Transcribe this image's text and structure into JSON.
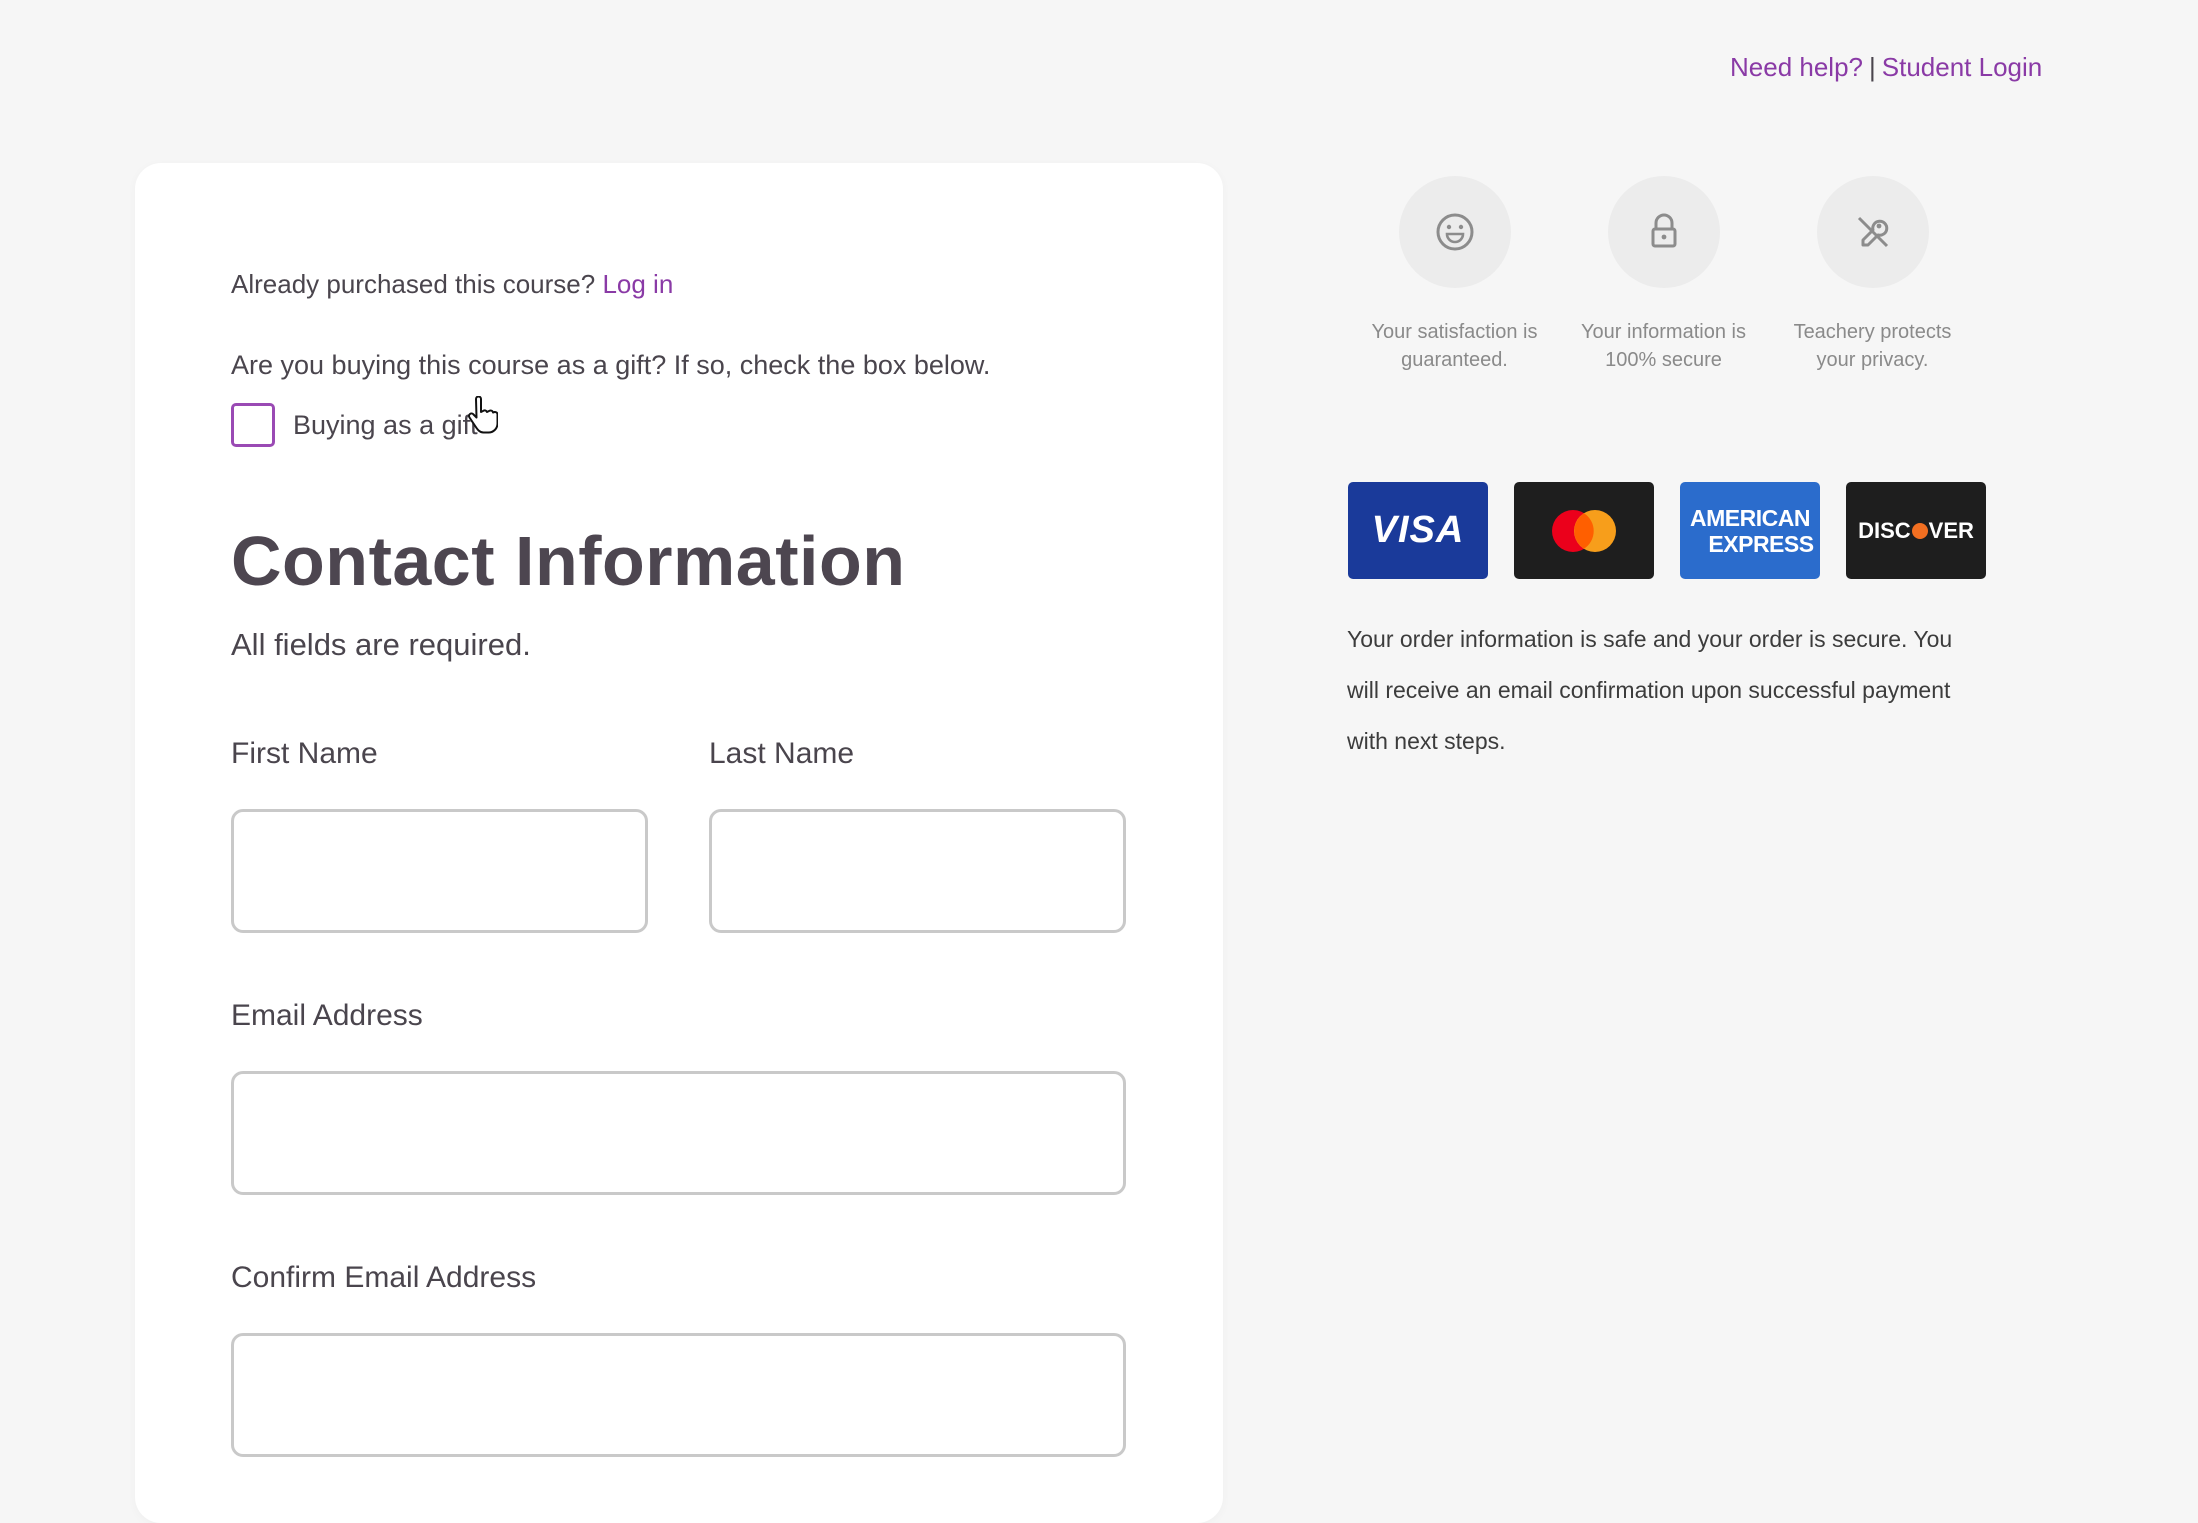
{
  "header": {
    "need_help": "Need help?",
    "separator": "|",
    "student_login": "Student Login"
  },
  "form": {
    "already_purchased": "Already purchased this course?",
    "log_in": "Log in",
    "gift_question": "Are you buying this course as a gift? If so, check the box below.",
    "gift_checkbox_label": "Buying as a gift",
    "gift_checked": false,
    "title": "Contact Information",
    "subtitle": "All fields are required.",
    "first_name_label": "First Name",
    "first_name_value": "",
    "last_name_label": "Last Name",
    "last_name_value": "",
    "email_label": "Email Address",
    "email_value": "",
    "confirm_email_label": "Confirm Email Address",
    "confirm_email_value": ""
  },
  "badges": [
    {
      "icon": "smile-icon",
      "text": "Your satisfaction is guaranteed."
    },
    {
      "icon": "lock-icon",
      "text": "Your information is 100% secure"
    },
    {
      "icon": "privacy-icon",
      "text": "Teachery protects your privacy."
    }
  ],
  "payment_cards": [
    {
      "name": "visa",
      "label": "VISA",
      "color": "#1a3a9a"
    },
    {
      "name": "mastercard",
      "label": "",
      "color": "#1e1e1e"
    },
    {
      "name": "amex",
      "label_line1": "AMERICAN",
      "label_line2": "EXPRESS",
      "color": "#2b6ccc"
    },
    {
      "name": "discover",
      "label_a": "DISC",
      "label_b": "VER",
      "color": "#1e1e1e"
    }
  ],
  "secure_text": "Your order information is safe and your order is secure. You will receive an email confirmation upon successful payment with next steps.",
  "colors": {
    "accent": "#8a3aa6",
    "background": "#f6f6f6",
    "card": "#ffffff"
  }
}
